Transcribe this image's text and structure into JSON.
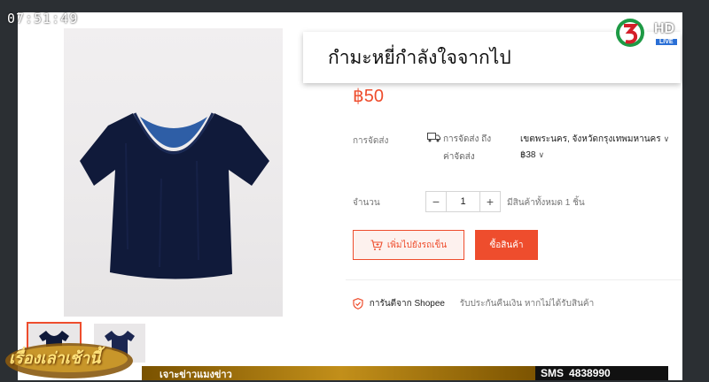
{
  "broadcast": {
    "clock": "07:51:49",
    "channel_hd": "HD",
    "channel_live": "LIVE",
    "headline": "กำมะหยี่กำลังใจจากไป",
    "show_logo": "เรื่องเล่าเช้านี้",
    "ticker": "เจาะข่าวแมงข่าว",
    "sms_label": "SMS",
    "sms_number": "4838990"
  },
  "product": {
    "price": "฿50",
    "shipping": {
      "label": "การจัดส่ง",
      "option_line1": "การจัดส่ง ถึง",
      "option_line2": "ค่าจัดส่ง",
      "destination": "เขตพระนคร, จังหวัดกรุงเทพมหานคร",
      "fee": "฿38"
    },
    "quantity": {
      "label": "จำนวน",
      "minus": "−",
      "value": "1",
      "plus": "+",
      "stock_text": "มีสินค้าทั้งหมด 1 ชิ้น"
    },
    "add_to_cart_label": "เพิ่มไปยังรถเข็น",
    "buy_now_label": "ซื้อสินค้า",
    "guarantee_title": "การันตีจาก Shopee",
    "guarantee_desc": "รับประกันคืนเงิน หากไม่ได้รับสินค้า"
  },
  "colors": {
    "accent": "#ee4d2d",
    "shirt": "#0f1a3a"
  }
}
